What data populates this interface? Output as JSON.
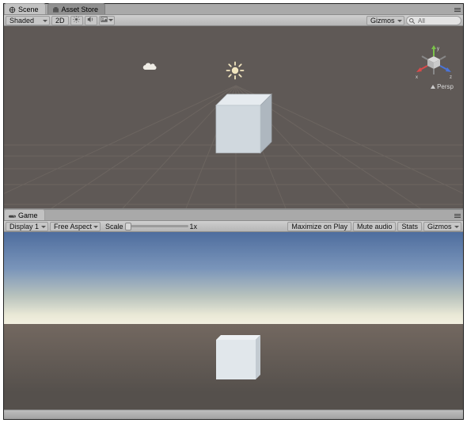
{
  "tabs": {
    "scene": "Scene",
    "asset_store": "Asset Store"
  },
  "scene_toolbar": {
    "shading_mode": "Shaded",
    "btn_2d": "2D",
    "gizmos": "Gizmos",
    "search": {
      "placeholder": "All"
    }
  },
  "gizmo": {
    "x": "x",
    "y": "y",
    "z": "z",
    "projection": "Persp"
  },
  "game_tab": "Game",
  "game_toolbar": {
    "display": "Display 1",
    "aspect": "Free Aspect",
    "scale_label": "Scale",
    "scale_value": "1x",
    "maximize": "Maximize on Play",
    "mute": "Mute audio",
    "stats": "Stats",
    "gizmos": "Gizmos"
  },
  "colors": {
    "axis_x": "#d94a4a",
    "axis_y": "#7ac24a",
    "axis_z": "#4a74d9"
  }
}
